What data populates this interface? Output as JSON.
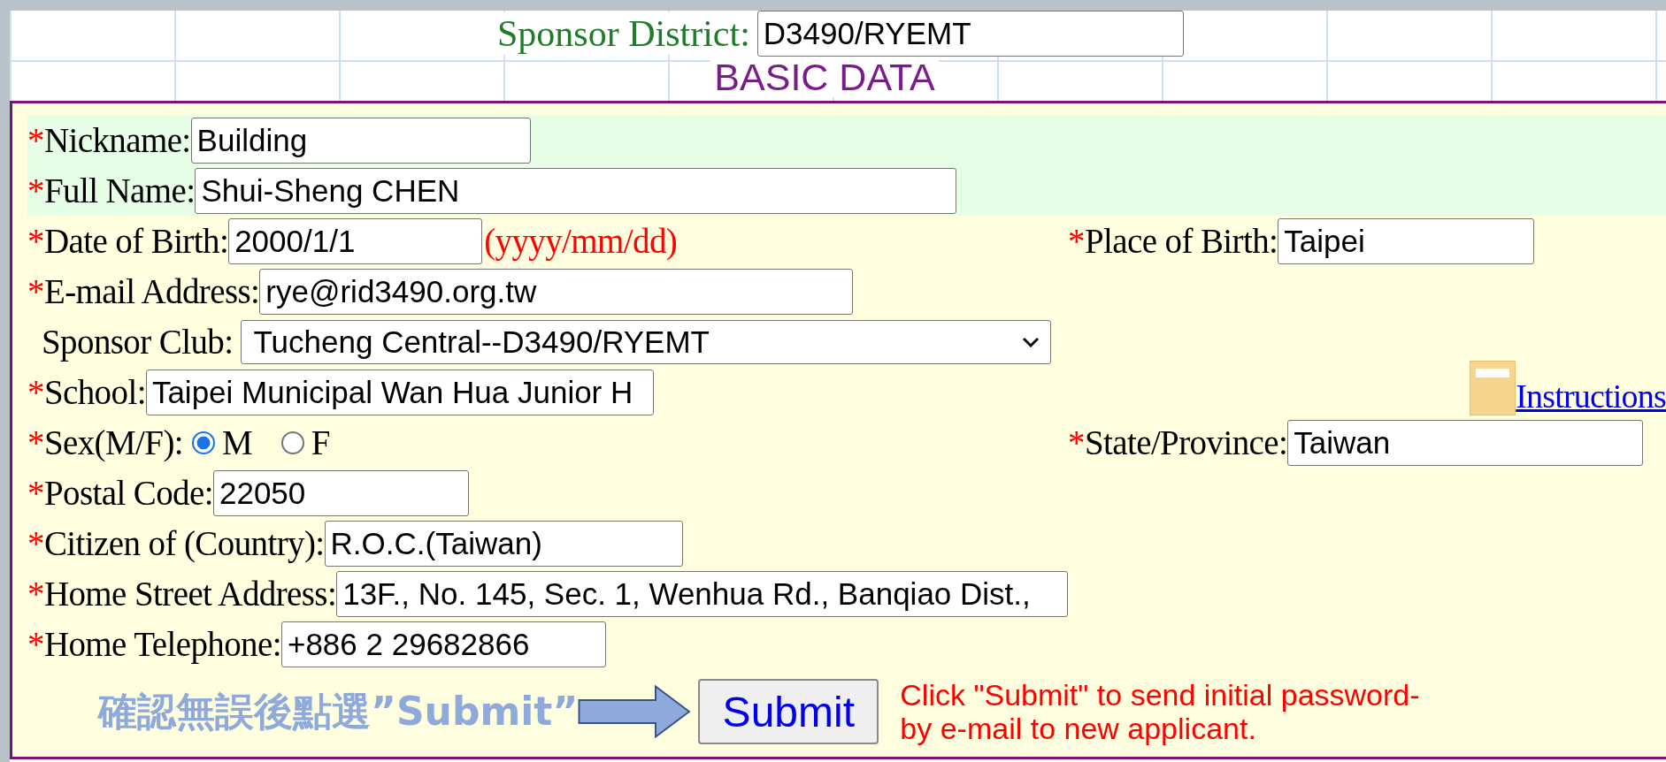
{
  "sponsor_district": {
    "label": "Sponsor District:",
    "value": "D3490/RYEMT"
  },
  "section_title": "BASIC DATA",
  "rows": [
    {
      "highlighted": true,
      "fields": [
        {
          "kind": "text",
          "required_mark": "*",
          "label": "Nickname:",
          "value": "Building"
        }
      ]
    },
    {
      "highlighted": true,
      "fields": [
        {
          "kind": "text",
          "required_mark": "*",
          "label": "Full Name:",
          "value": "Shui-Sheng CHEN"
        }
      ]
    },
    {
      "highlighted": false,
      "fields": [
        {
          "kind": "text",
          "required_mark": "*",
          "label": "Date of Birth:",
          "value": "2000/1/1",
          "hint": "(yyyy/mm/dd)"
        },
        {
          "kind": "text",
          "required_mark": "*",
          "label": "Place of Birth:",
          "value": "Taipei"
        }
      ]
    },
    {
      "highlighted": false,
      "fields": [
        {
          "kind": "text",
          "required_mark": "*",
          "label": "E-mail Address:",
          "value": "rye@rid3490.org.tw"
        }
      ]
    },
    {
      "highlighted": false,
      "fields": [
        {
          "kind": "select",
          "label": "Sponsor Club:",
          "value": "Tucheng Central--D3490/RYEMT"
        }
      ]
    },
    {
      "highlighted": false,
      "fields": [
        {
          "kind": "text",
          "required_mark": "*",
          "label": "School:",
          "value": "Taipei Municipal Wan Hua Junior H"
        },
        {
          "kind": "link",
          "label": "Instructions"
        }
      ]
    },
    {
      "highlighted": false,
      "fields": [
        {
          "kind": "radio",
          "required_mark": "*",
          "label": "Sex(M/F):",
          "options": [
            {
              "label": "M",
              "selected": true
            },
            {
              "label": "F",
              "selected": false
            }
          ]
        },
        {
          "kind": "text",
          "required_mark": "*",
          "label": "State/Province:",
          "value": "Taiwan"
        }
      ]
    },
    {
      "highlighted": false,
      "fields": [
        {
          "kind": "text",
          "required_mark": "*",
          "label": "Postal Code:",
          "value": "22050"
        }
      ]
    },
    {
      "highlighted": false,
      "fields": [
        {
          "kind": "text",
          "required_mark": "*",
          "label": "Citizen of (Country):",
          "value": "R.O.C.(Taiwan)"
        }
      ]
    },
    {
      "highlighted": false,
      "fields": [
        {
          "kind": "text",
          "required_mark": "*",
          "label": "Home Street Address:",
          "value": "13F., No. 145, Sec. 1, Wenhua Rd., Banqiao Dist.,"
        }
      ]
    },
    {
      "highlighted": false,
      "fields": [
        {
          "kind": "text",
          "required_mark": "*",
          "label": "Home Telephone:",
          "value": "+886 2 29682866"
        }
      ]
    }
  ],
  "submit": {
    "annotation": "確認無誤後點選”Submit”",
    "button": "Submit",
    "note_lines": [
      "Click \"Submit\" to send initial password-",
      "by e-mail to new applicant."
    ]
  }
}
